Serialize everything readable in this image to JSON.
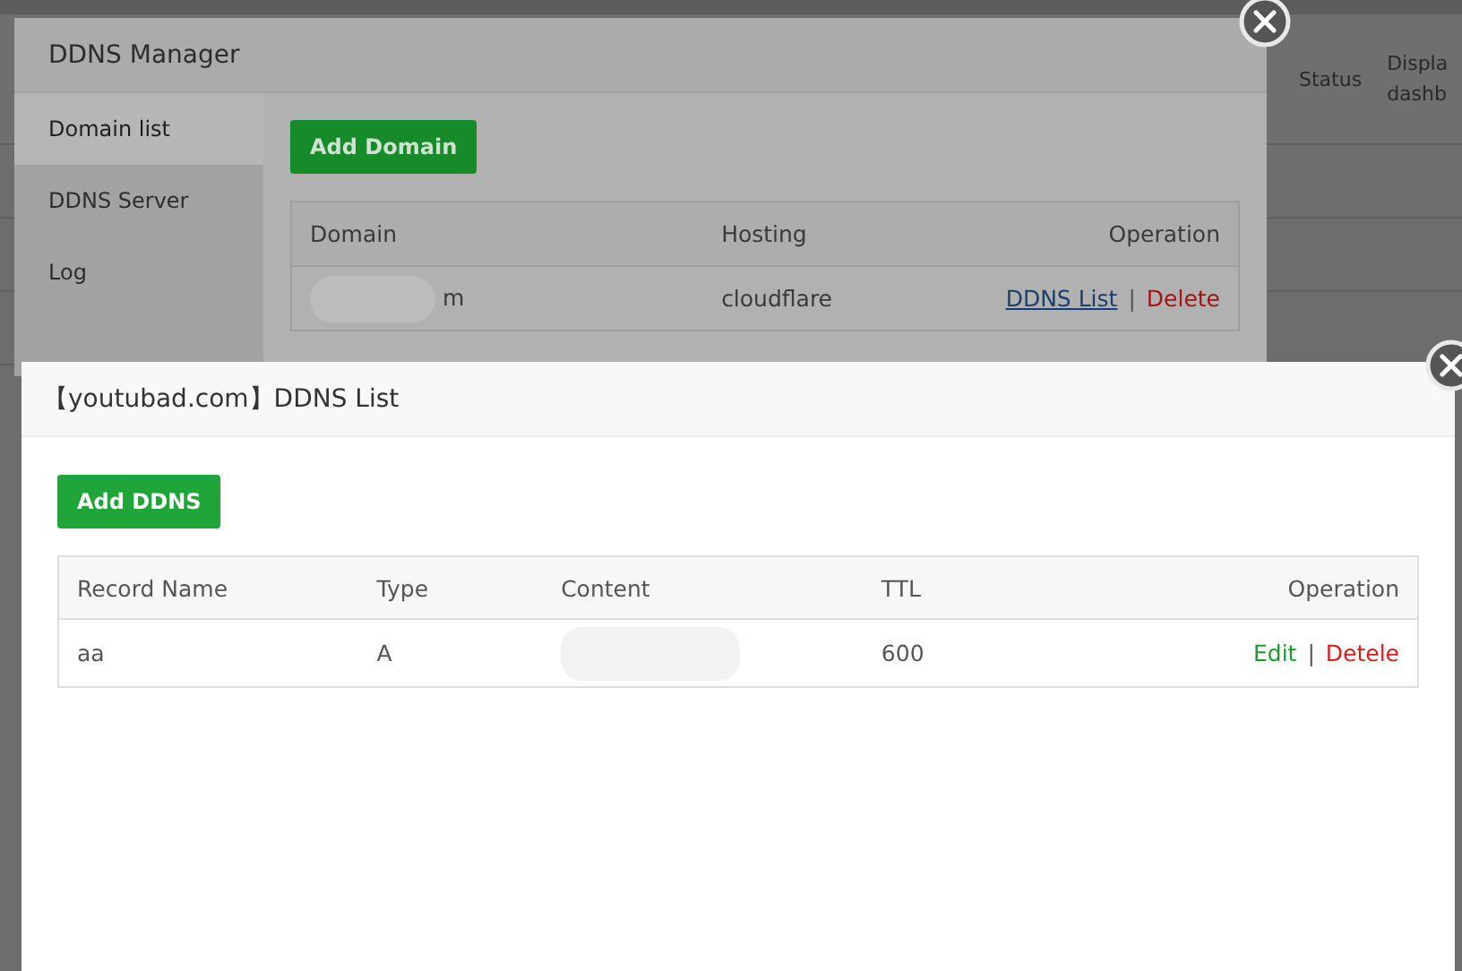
{
  "background_table": {
    "columns": [
      "Status",
      "Displa\ndashb"
    ]
  },
  "manager": {
    "title": "DDNS Manager",
    "sidebar": {
      "items": [
        {
          "label": "Domain list",
          "selected": true
        },
        {
          "label": "DDNS Server",
          "selected": false
        },
        {
          "label": "Log",
          "selected": false
        }
      ]
    },
    "add_button": "Add Domain",
    "table": {
      "columns": [
        "Domain",
        "Hosting",
        "Operation"
      ],
      "separator": "|",
      "rows": [
        {
          "domain": "m",
          "hosting": "cloudflare",
          "actions": [
            {
              "label": "DDNS List",
              "kind": "link"
            },
            {
              "label": "Delete",
              "kind": "danger"
            }
          ]
        }
      ]
    }
  },
  "ddns_list": {
    "title": "【youtubad.com】DDNS List",
    "add_button": "Add DDNS",
    "table": {
      "columns": [
        "Record Name",
        "Type",
        "Content",
        "TTL",
        "Operation"
      ],
      "separator": "|",
      "rows": [
        {
          "cells": [
            "aa",
            "A",
            "",
            "600"
          ],
          "actions": [
            {
              "label": "Edit",
              "kind": "edit"
            },
            {
              "label": "Detele",
              "kind": "danger"
            }
          ]
        }
      ]
    }
  }
}
